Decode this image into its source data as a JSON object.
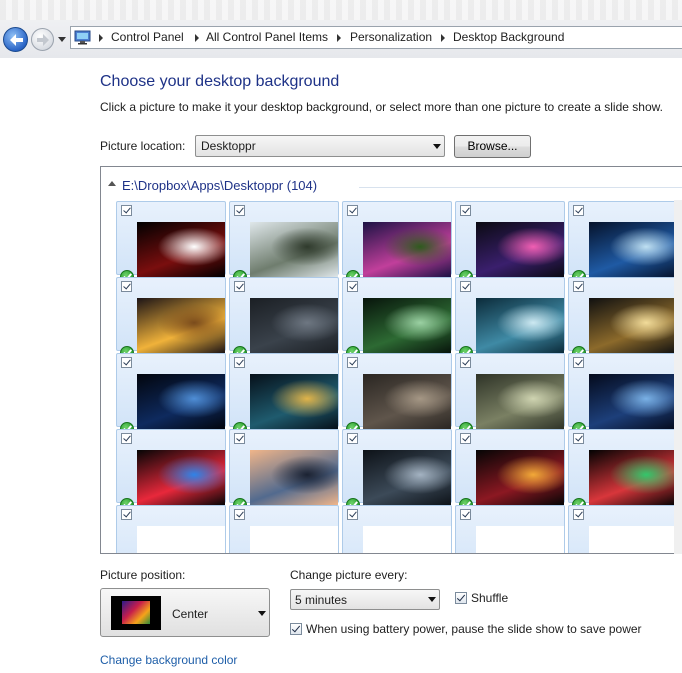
{
  "breadcrumbs": [
    "Control Panel",
    "All Control Panel Items",
    "Personalization",
    "Desktop Background"
  ],
  "title": "Choose your desktop background",
  "subtitle": "Click a picture to make it your desktop background, or select more than one picture to create a slide show.",
  "picture_location": {
    "label": "Picture location:",
    "value": "Desktoppr",
    "browse_label": "Browse..."
  },
  "folder": {
    "title": "E:\\Dropbox\\Apps\\Desktoppr (104)"
  },
  "thumbnails": [
    {
      "name": "coffee-cup",
      "colors": [
        "#000000",
        "#7a0e0e",
        "#ffffff"
      ],
      "checked": true
    },
    {
      "name": "eiffel-tower-city",
      "colors": [
        "#dfe7ea",
        "#6f7d6e",
        "#2f3a2c"
      ],
      "checked": true
    },
    {
      "name": "purple-sunset-field",
      "colors": [
        "#1c1245",
        "#c13f9b",
        "#2e5b1d"
      ],
      "checked": true
    },
    {
      "name": "galaxy-jar",
      "colors": [
        "#0a0a12",
        "#3a1f6d",
        "#f15fb3"
      ],
      "checked": true
    },
    {
      "name": "planet-horizon",
      "colors": [
        "#05122b",
        "#1f5aa4",
        "#bfe0f2"
      ],
      "checked": true
    },
    {
      "name": "city-street-night",
      "colors": [
        "#1c1416",
        "#f0b23a",
        "#7a4b1c"
      ],
      "checked": true
    },
    {
      "name": "batman-logo",
      "colors": [
        "#1b1f24",
        "#3a424b",
        "#6e7782"
      ],
      "checked": true
    },
    {
      "name": "green-forest-creature",
      "colors": [
        "#07140b",
        "#2d6a33",
        "#9bd1a3"
      ],
      "checked": true
    },
    {
      "name": "underwater-light",
      "colors": [
        "#0b2b3a",
        "#3f8aa5",
        "#cde9f2"
      ],
      "checked": true
    },
    {
      "name": "tree-sunrise",
      "colors": [
        "#101010",
        "#8c6a2b",
        "#f2dc9a"
      ],
      "checked": true
    },
    {
      "name": "earth-space",
      "colors": [
        "#02050d",
        "#0e2a5e",
        "#4f8ed6"
      ],
      "checked": true
    },
    {
      "name": "lego-troopers",
      "colors": [
        "#06101a",
        "#1f5b6e",
        "#e1b44a"
      ],
      "checked": true
    },
    {
      "name": "rainy-window",
      "colors": [
        "#2a2622",
        "#5f554b",
        "#a59785"
      ],
      "checked": true
    },
    {
      "name": "misty-path-walker",
      "colors": [
        "#2e3327",
        "#7a8063",
        "#cfd4b1"
      ],
      "checked": true
    },
    {
      "name": "blue-night-forest",
      "colors": [
        "#040a1c",
        "#1d3f7a",
        "#7ab1e6"
      ],
      "checked": true
    },
    {
      "name": "rainbow-spectrum",
      "colors": [
        "#050505",
        "#e8283b",
        "#2f83e8"
      ],
      "checked": true
    },
    {
      "name": "new-york-skyline",
      "colors": [
        "#f0b58a",
        "#526a8e",
        "#1b2232"
      ],
      "checked": true
    },
    {
      "name": "sci-fi-city",
      "colors": [
        "#0d1218",
        "#3c4a58",
        "#a4b3c2"
      ],
      "checked": true
    },
    {
      "name": "cyclists-night",
      "colors": [
        "#050505",
        "#8c1822",
        "#f2a938"
      ],
      "checked": true
    },
    {
      "name": "bokeh-lights",
      "colors": [
        "#020202",
        "#d8363b",
        "#33c76b"
      ],
      "checked": true
    },
    {
      "name": "row5-col1",
      "colors": [
        "#ffffff",
        "#ffffff",
        "#ffffff"
      ],
      "checked": true
    },
    {
      "name": "row5-col2",
      "colors": [
        "#ffffff",
        "#ffffff",
        "#ffffff"
      ],
      "checked": true
    },
    {
      "name": "row5-col3",
      "colors": [
        "#ffffff",
        "#ffffff",
        "#ffffff"
      ],
      "checked": true
    },
    {
      "name": "row5-col4",
      "colors": [
        "#ffffff",
        "#ffffff",
        "#ffffff"
      ],
      "checked": true
    },
    {
      "name": "row5-col5",
      "colors": [
        "#ffffff",
        "#ffffff",
        "#ffffff"
      ],
      "checked": true
    }
  ],
  "picture_position": {
    "label": "Picture position:",
    "value": "Center"
  },
  "change_picture": {
    "label": "Change picture every:",
    "value": "5 minutes"
  },
  "shuffle": {
    "label": "Shuffle",
    "checked": true
  },
  "battery": {
    "label": "When using battery power, pause the slide show to save power",
    "checked": true
  },
  "background_color_link": "Change background color",
  "colors": {
    "title": "#1e3287",
    "link": "#1e5ea8",
    "tile_selected": "#d2e4f8",
    "check_green": "#239a2b"
  }
}
